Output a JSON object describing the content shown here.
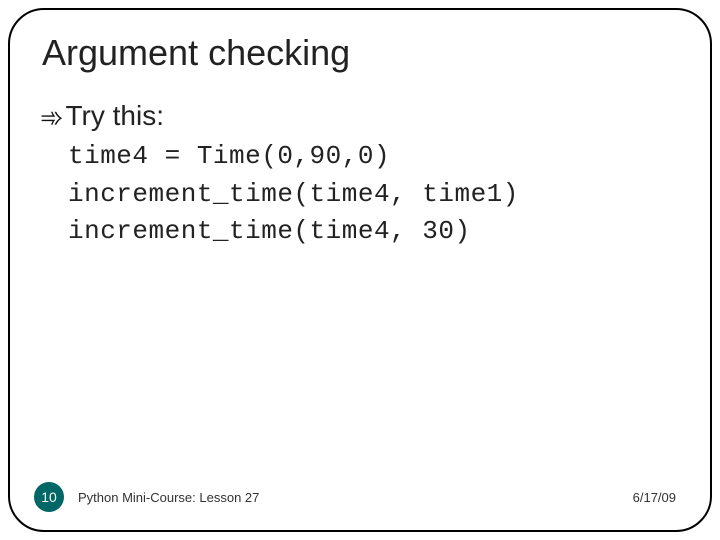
{
  "title": "Argument checking",
  "bullet": {
    "label": "Try this:"
  },
  "code": "time4 = Time(0,90,0)\nincrement_time(time4, time1)\nincrement_time(time4, 30)",
  "footer": {
    "page": "10",
    "course": "Python Mini-Course: Lesson 27",
    "date": "6/17/09"
  }
}
